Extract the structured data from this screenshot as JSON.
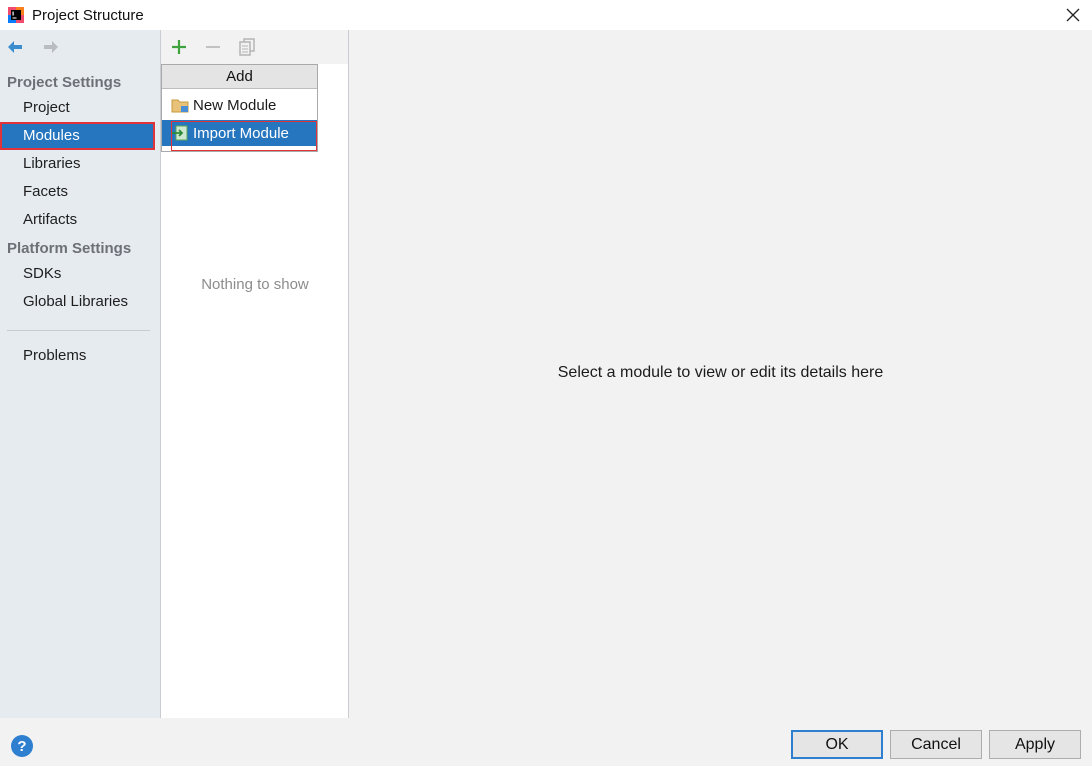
{
  "window": {
    "title": "Project Structure"
  },
  "sidebar": {
    "sections": [
      {
        "header": "Project Settings",
        "items": [
          "Project",
          "Modules",
          "Libraries",
          "Facets",
          "Artifacts"
        ]
      },
      {
        "header": "Platform Settings",
        "items": [
          "SDKs",
          "Global Libraries"
        ]
      }
    ],
    "extra_items": [
      "Problems"
    ],
    "selected": "Modules"
  },
  "middle": {
    "empty_text": "Nothing to show"
  },
  "popup": {
    "header": "Add",
    "items": [
      "New Module",
      "Import Module"
    ],
    "selected": "Import Module"
  },
  "details": {
    "message": "Select a module to view or edit its details here"
  },
  "footer": {
    "help": "?",
    "ok_label": "OK",
    "cancel_label": "Cancel",
    "apply_label": "Apply"
  },
  "colors": {
    "selection": "#2675bf",
    "highlight_border": "#e0333a",
    "sidebar_bg": "#e6ebf0",
    "add_icon": "#3ea33e"
  }
}
